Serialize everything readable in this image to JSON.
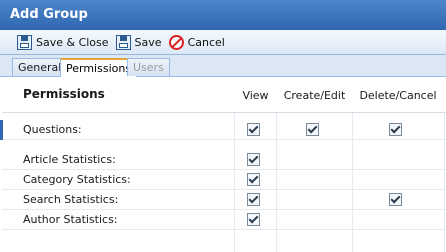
{
  "window": {
    "title": "Add Group"
  },
  "toolbar": {
    "save_close_label": "Save & Close",
    "save_label": "Save",
    "cancel_label": "Cancel"
  },
  "tabs": [
    {
      "label": "General",
      "state": "normal"
    },
    {
      "label": "Permissions",
      "state": "active"
    },
    {
      "label": "Users",
      "state": "disabled"
    }
  ],
  "permissions": {
    "title": "Permissions",
    "columns": [
      "View",
      "Create/Edit",
      "Delete/Cancel"
    ],
    "rows": [
      {
        "label": "Questions:",
        "view": true,
        "create_edit": true,
        "delete_cancel": true
      },
      {
        "label": "Article Statistics:",
        "view": true,
        "create_edit": null,
        "delete_cancel": null
      },
      {
        "label": "Category Statistics:",
        "view": true,
        "create_edit": null,
        "delete_cancel": null
      },
      {
        "label": "Search Statistics:",
        "view": true,
        "create_edit": null,
        "delete_cancel": true
      },
      {
        "label": "Author Statistics:",
        "view": true,
        "create_edit": null,
        "delete_cancel": null
      }
    ]
  },
  "colors": {
    "titlebar": "#3a73bc",
    "active_tab_accent": "#e0a43a",
    "cancel_icon": "#d72020"
  }
}
